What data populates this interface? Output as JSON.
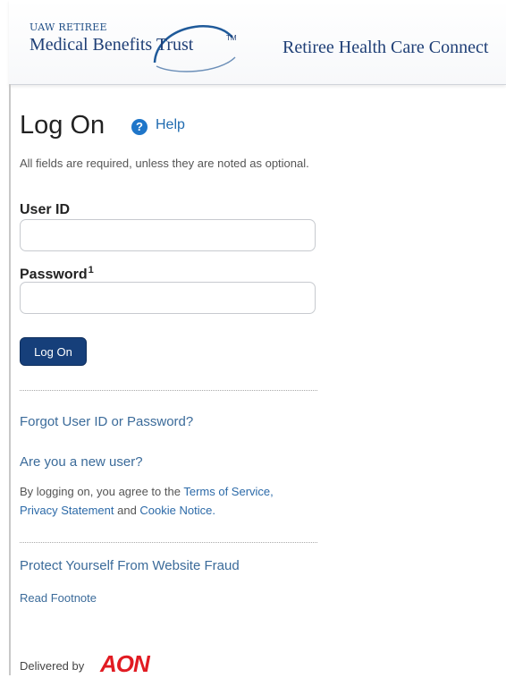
{
  "header": {
    "logo_small": "UAW RETIREE",
    "logo_main": "Medical Benefits Trust",
    "logo_tm": "TM",
    "tagline": "Retiree Health Care Connect"
  },
  "login": {
    "title": "Log On",
    "help_label": "Help",
    "required_note": "All fields are required, unless they are noted as optional.",
    "user_id_label": "User ID",
    "user_id_value": "",
    "password_label": "Password",
    "password_footnote_marker": "1",
    "password_value": "",
    "submit_label": "Log On"
  },
  "links": {
    "forgot": "Forgot User ID or Password?",
    "new_user": "Are you a new user?",
    "agree_prefix": "By logging on, you agree to the ",
    "terms": "Terms of Service,",
    "privacy": "Privacy Statement",
    "and": " and ",
    "cookie": "Cookie Notice.",
    "fraud": "Protect Yourself From Website Fraud",
    "read_footnote": "Read Footnote"
  },
  "footer": {
    "delivered_by": "Delivered by",
    "brand": "AON"
  },
  "colors": {
    "brand_blue": "#1f3f76",
    "button": "#163f7a",
    "link": "#3b6b9a",
    "aon_red": "#e11b22"
  }
}
